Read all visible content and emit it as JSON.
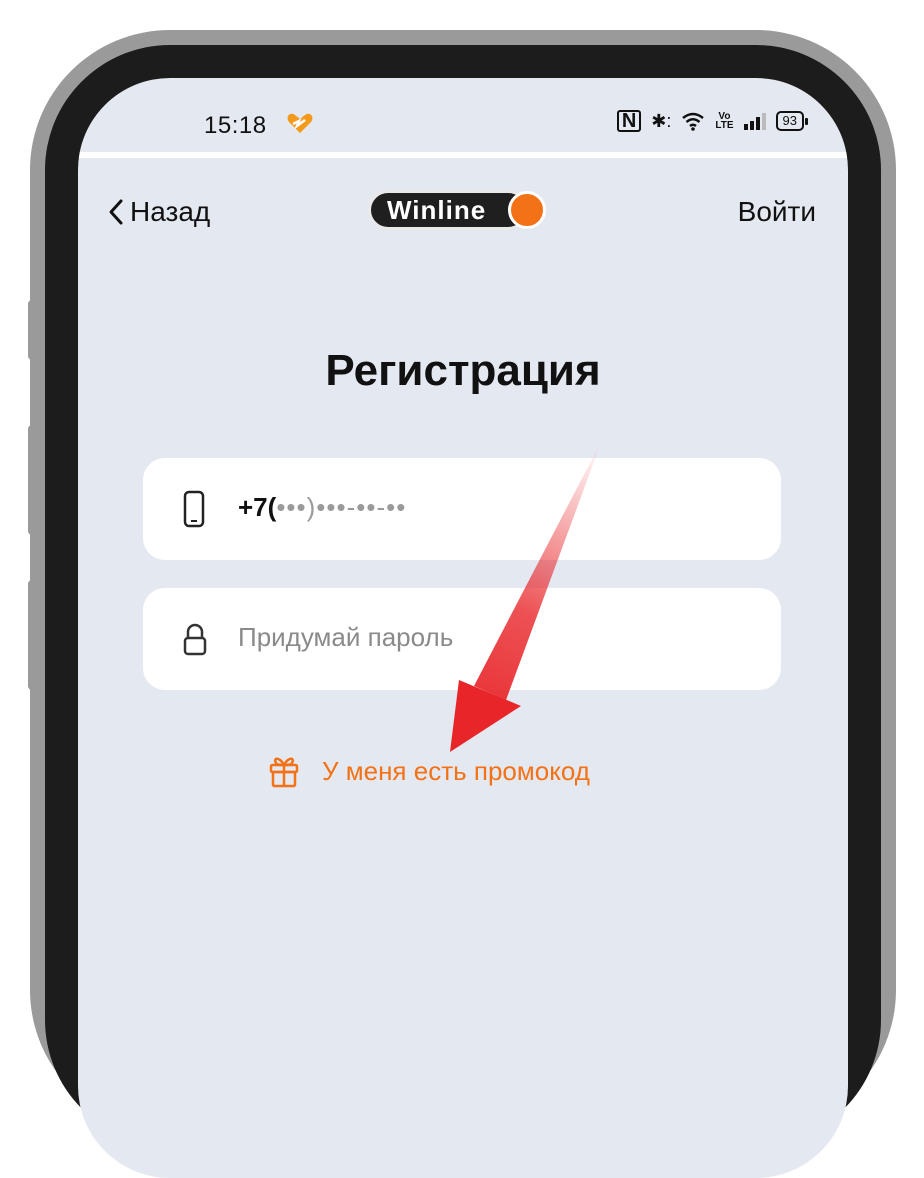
{
  "status_bar": {
    "time": "15:18",
    "nfc": "N",
    "bluetooth": "✱:",
    "wifi": "ᯤ",
    "volte_top": "Vo",
    "volte_bottom": "LTE",
    "battery": "93"
  },
  "nav": {
    "back_label": "Назад",
    "login_label": "Войти",
    "logo_text": "Winline"
  },
  "page": {
    "title": "Регистрация"
  },
  "form": {
    "phone_prefix": "+7(",
    "phone_mask_1": "•••",
    "phone_sep": ")",
    "phone_mask_2": "•••-••-••",
    "password_placeholder": "Придумай пароль"
  },
  "promo": {
    "label": "У меня есть промокод"
  },
  "colors": {
    "accent": "#f47216",
    "background": "#e4e8f1",
    "annotation_arrow": "#e8262a"
  }
}
